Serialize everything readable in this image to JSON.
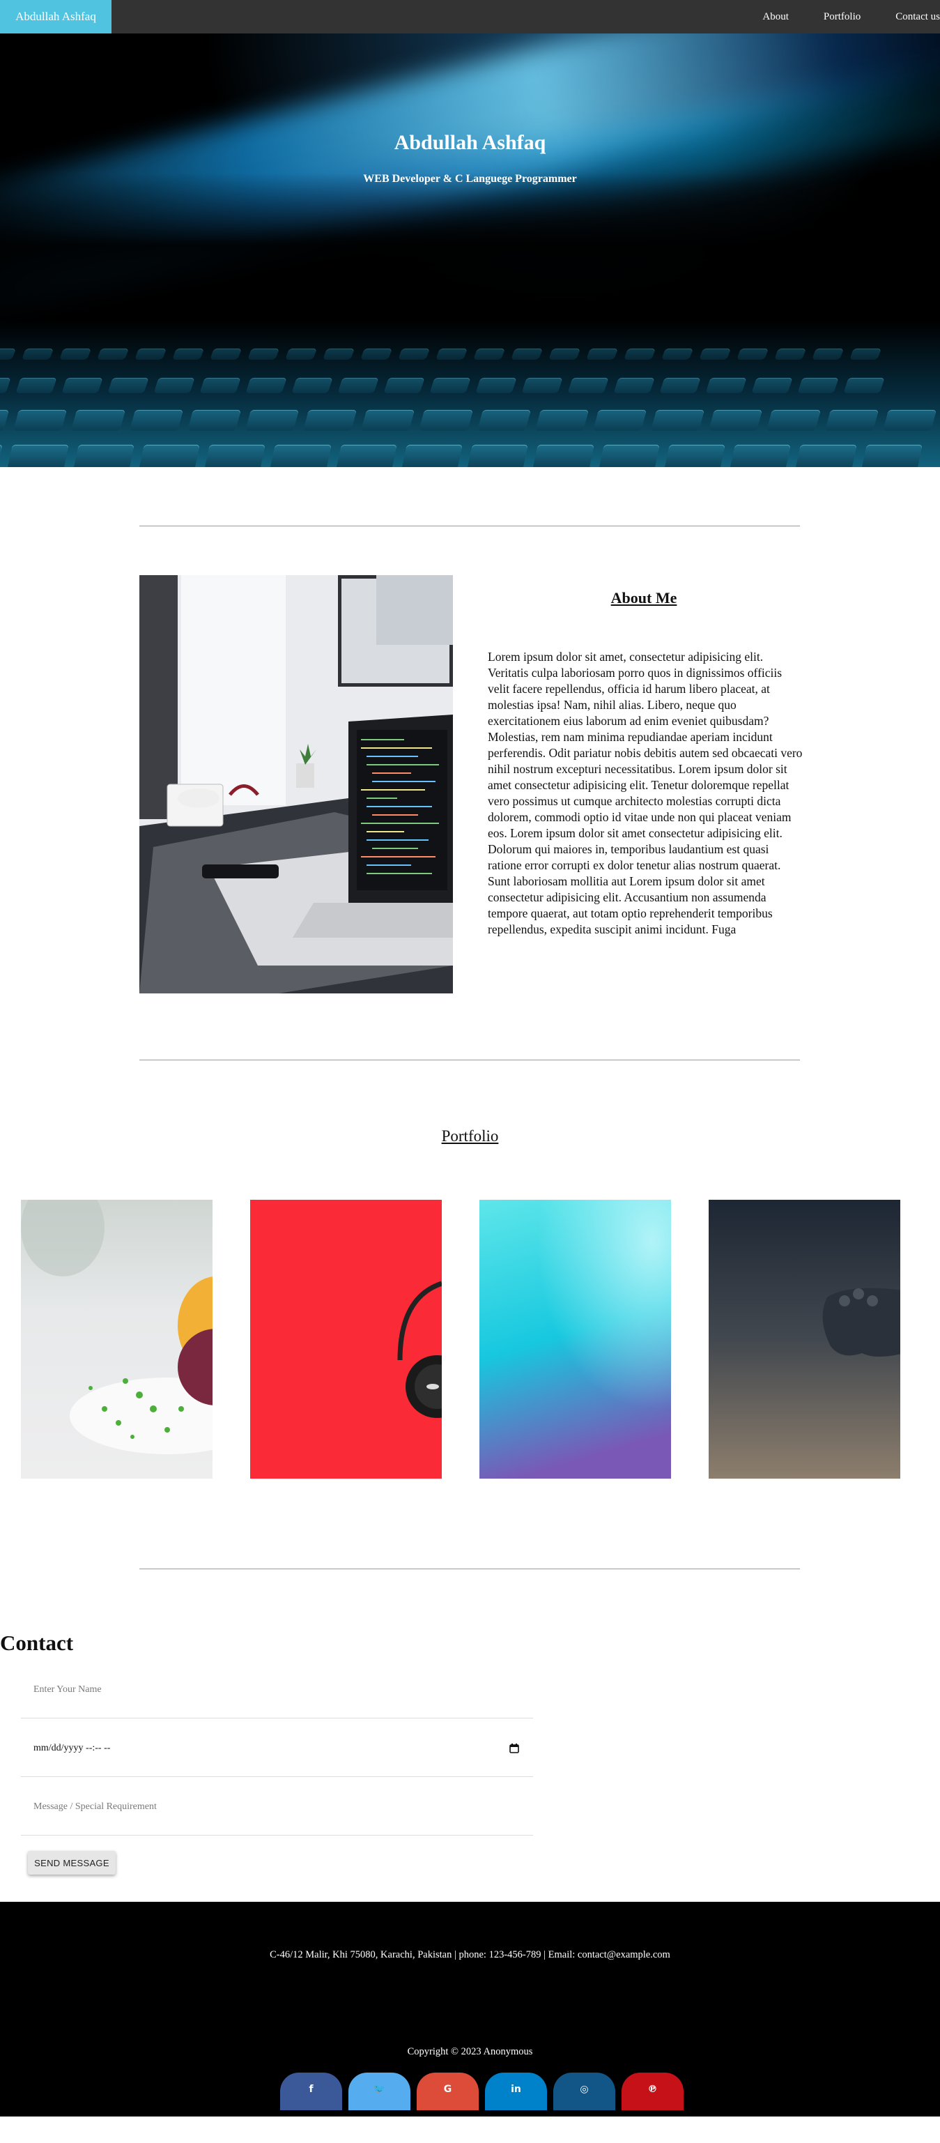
{
  "nav": {
    "brand": "Abdullah Ashfaq",
    "links": [
      "About",
      "Portfolio",
      "Contact us"
    ]
  },
  "hero": {
    "title": "Abdullah Ashfaq",
    "subtitle": "WEB Developer & C Languege Programmer"
  },
  "about": {
    "title": "About Me",
    "text": "Lorem ipsum dolor sit amet, consectetur adipisicing elit. Veritatis culpa laboriosam porro quos in dignissimos officiis velit facere repellendus, officia id harum libero placeat, at molestias ipsa! Nam, nihil alias. Libero, neque quo exercitationem eius laborum ad enim eveniet quibusdam? Molestias, rem nam minima repudiandae aperiam incidunt perferendis. Odit pariatur nobis debitis autem sed obcaecati vero nihil nostrum excepturi necessitatibus. Lorem ipsum dolor sit amet consectetur adipisicing elit. Tenetur doloremque repellat vero possimus ut cumque architecto molestias corrupti dicta dolorem, commodi optio id vitae unde non qui placeat veniam eos. Lorem ipsum dolor sit amet consectetur adipisicing elit. Dolorum qui maiores in, temporibus laudantium est quasi ratione error corrupti ex dolor tenetur alias nostrum quaerat. Sunt laboriosam mollitia aut Lorem ipsum dolor sit amet consectetur adipisicing elit. Accusantium non assumenda tempore quaerat, aut totam optio reprehenderit temporibus repellendus, expedita suscipit animi incidunt. Fuga"
  },
  "portfolio": {
    "title": "Portfolio"
  },
  "contact": {
    "title": "Contact",
    "name_placeholder": "Enter Your Name",
    "datetime_value": "mm/dd/yyyy --:-- --",
    "message_placeholder": "Message / Special Requirement",
    "send_label": "SEND MESSAGE"
  },
  "footer": {
    "address": "C-46/12 Malir, Khi 75080, Karachi, Pakistan | phone: 123-456-789 | Email: contact@example.com",
    "copyright": "Copyright © 2023 Anonymous",
    "social": [
      {
        "icon": "facebook-icon",
        "glyph": "f",
        "color": "#3b5998"
      },
      {
        "icon": "twitter-icon",
        "glyph": "🐦",
        "color": "#55acee"
      },
      {
        "icon": "google-icon",
        "glyph": "G",
        "color": "#dd4b39"
      },
      {
        "icon": "linkedin-icon",
        "glyph": "in",
        "color": "#0082ca"
      },
      {
        "icon": "instagram-icon",
        "glyph": "◎",
        "color": "#125688"
      },
      {
        "icon": "pinterest-icon",
        "glyph": "℗",
        "color": "#c61118"
      }
    ]
  },
  "colors": {
    "nav_bg": "#333333",
    "brand_bg": "#4fc3e0",
    "footer_bg": "#000000"
  }
}
